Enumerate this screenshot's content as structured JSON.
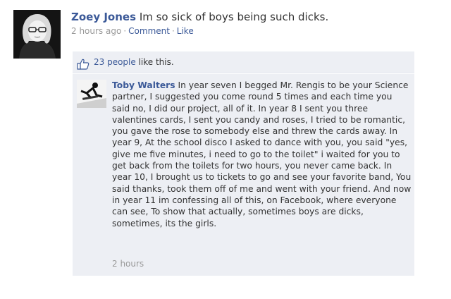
{
  "post": {
    "author": "Zoey Jones",
    "status": "Im so sick of boys being such dicks.",
    "time": "2 hours ago",
    "separator": "·",
    "comment_link": "Comment",
    "like_link": "Like"
  },
  "likes": {
    "count_text": "23 people",
    "suffix": "like this."
  },
  "comment": {
    "author": "Toby Walters",
    "text": "In year seven I begged Mr. Rengis to be your Science partner, I suggested you come round 5 times and each time you said no, I did our project, all of it. In year 8 I sent you three valentines cards, I sent you candy and roses, I tried to be romantic, you gave the rose to somebody else and threw the cards away. In year 9, At the school disco I asked to dance with you, you said \"yes, give me five minutes, i need to go to the toilet\" i waited for you to get back from the toilets for two hours, you never came back. In year 10, I brought us to tickets to go and see your favorite band, You said thanks, took them off of me and went with your friend. And now in year 11 im confessing all of this, on Facebook, where everyone can see, To show that actually, sometimes boys are dicks, sometimes, its the girls.",
    "time": "2 hours"
  },
  "colors": {
    "link": "#3b5998",
    "meta": "#999999",
    "box_bg": "#edeff4"
  },
  "icons": {
    "like": "thumbs-up-icon"
  }
}
